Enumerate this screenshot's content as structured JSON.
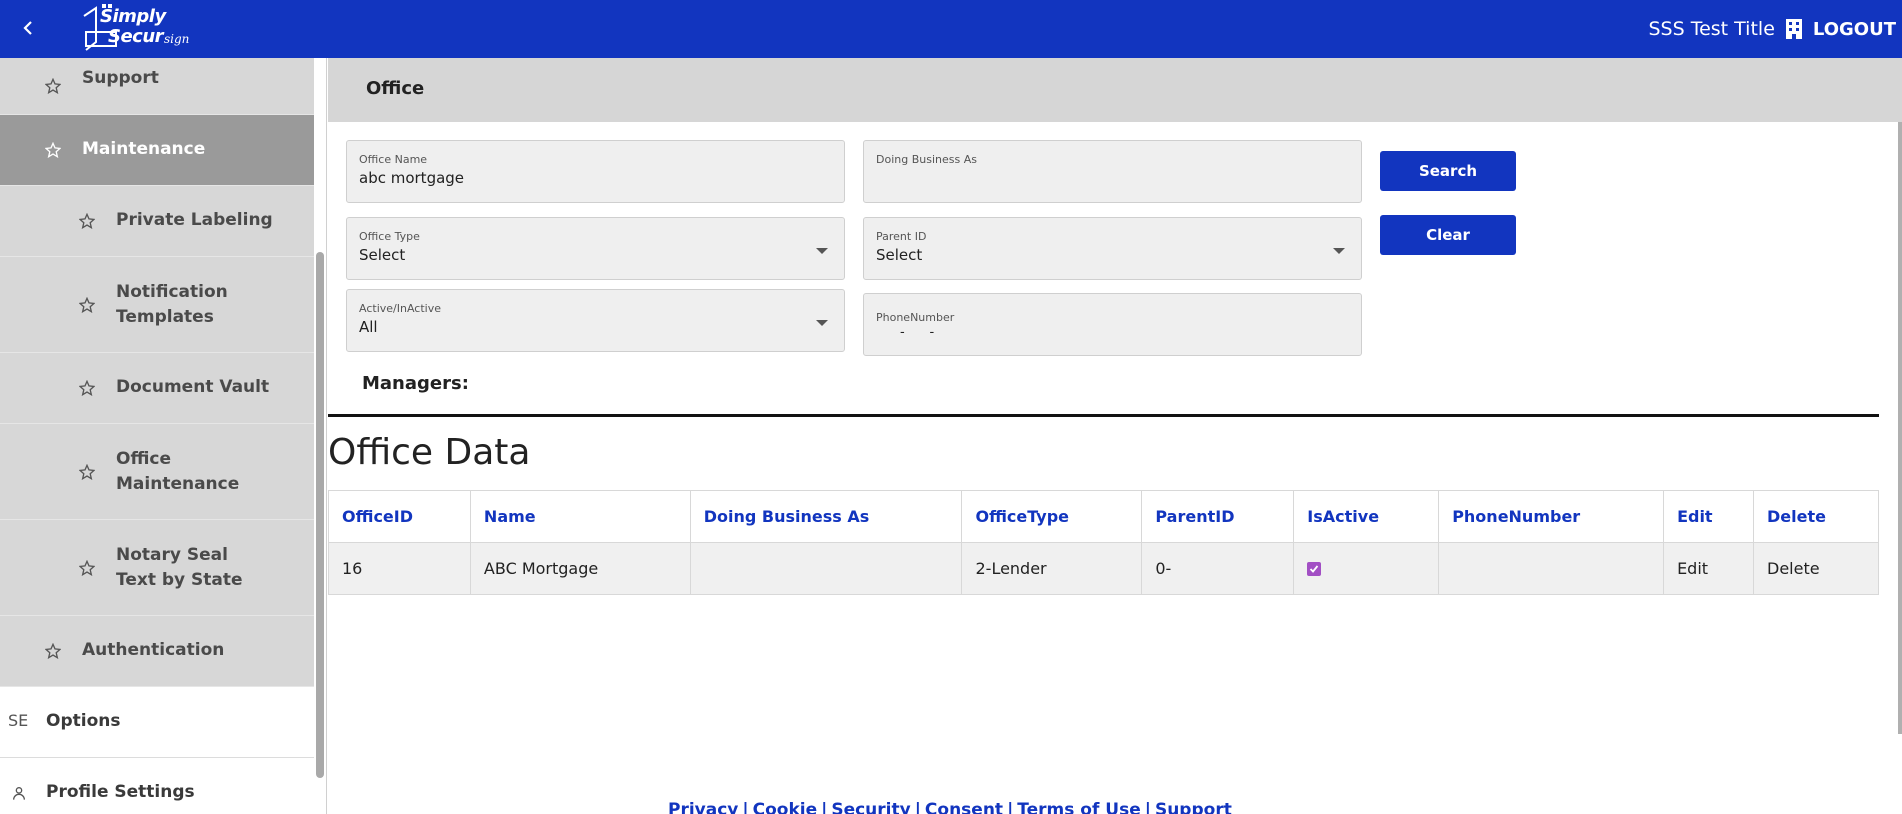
{
  "header": {
    "logo_line1": "Simply",
    "logo_line2": "Secur",
    "logo_line3": "sign",
    "title": "SSS Test Title",
    "logout_label": "LOGOUT"
  },
  "sidebar": {
    "items": [
      {
        "label": "Support"
      },
      {
        "label": "Maintenance"
      },
      {
        "label": "Private Labeling"
      },
      {
        "label": "Notification Templates"
      },
      {
        "label": "Document Vault"
      },
      {
        "label": "Office Maintenance"
      },
      {
        "label": "Notary Seal Text by State"
      },
      {
        "label": "Authentication"
      },
      {
        "label": "Options",
        "icon_text": "SE"
      },
      {
        "label": "Profile Settings"
      }
    ]
  },
  "page": {
    "title": "Office",
    "managers_label": "Managers:",
    "data_heading": "Office Data"
  },
  "form": {
    "office_name_label": "Office Name",
    "office_name_value": "abc mortgage",
    "dba_label": "Doing Business As",
    "dba_value": "",
    "office_type_label": "Office Type",
    "office_type_value": "Select",
    "parent_id_label": "Parent ID",
    "parent_id_value": "Select",
    "active_label": "Active/InActive",
    "active_value": "All",
    "phone_label": "PhoneNumber",
    "phone_value": "-      -",
    "search_label": "Search",
    "clear_label": "Clear"
  },
  "table": {
    "headers": [
      "OfficeID",
      "Name",
      "Doing Business As",
      "OfficeType",
      "ParentID",
      "IsActive",
      "PhoneNumber",
      "Edit",
      "Delete"
    ],
    "rows": [
      {
        "office_id": "16",
        "name": "ABC Mortgage",
        "dba": "",
        "office_type": "2-Lender",
        "parent_id": "0-",
        "is_active": true,
        "phone": "",
        "edit": "Edit",
        "delete": "Delete"
      }
    ]
  },
  "footer": {
    "links": [
      "Privacy",
      "Cookie",
      "Security",
      "Consent",
      "Terms of Use",
      "Support"
    ]
  },
  "colors": {
    "brand": "#1235bf",
    "sidebar_bg": "#d7d7d7",
    "sidebar_active": "#9a9a9a",
    "checkbox": "#a24fc4"
  }
}
